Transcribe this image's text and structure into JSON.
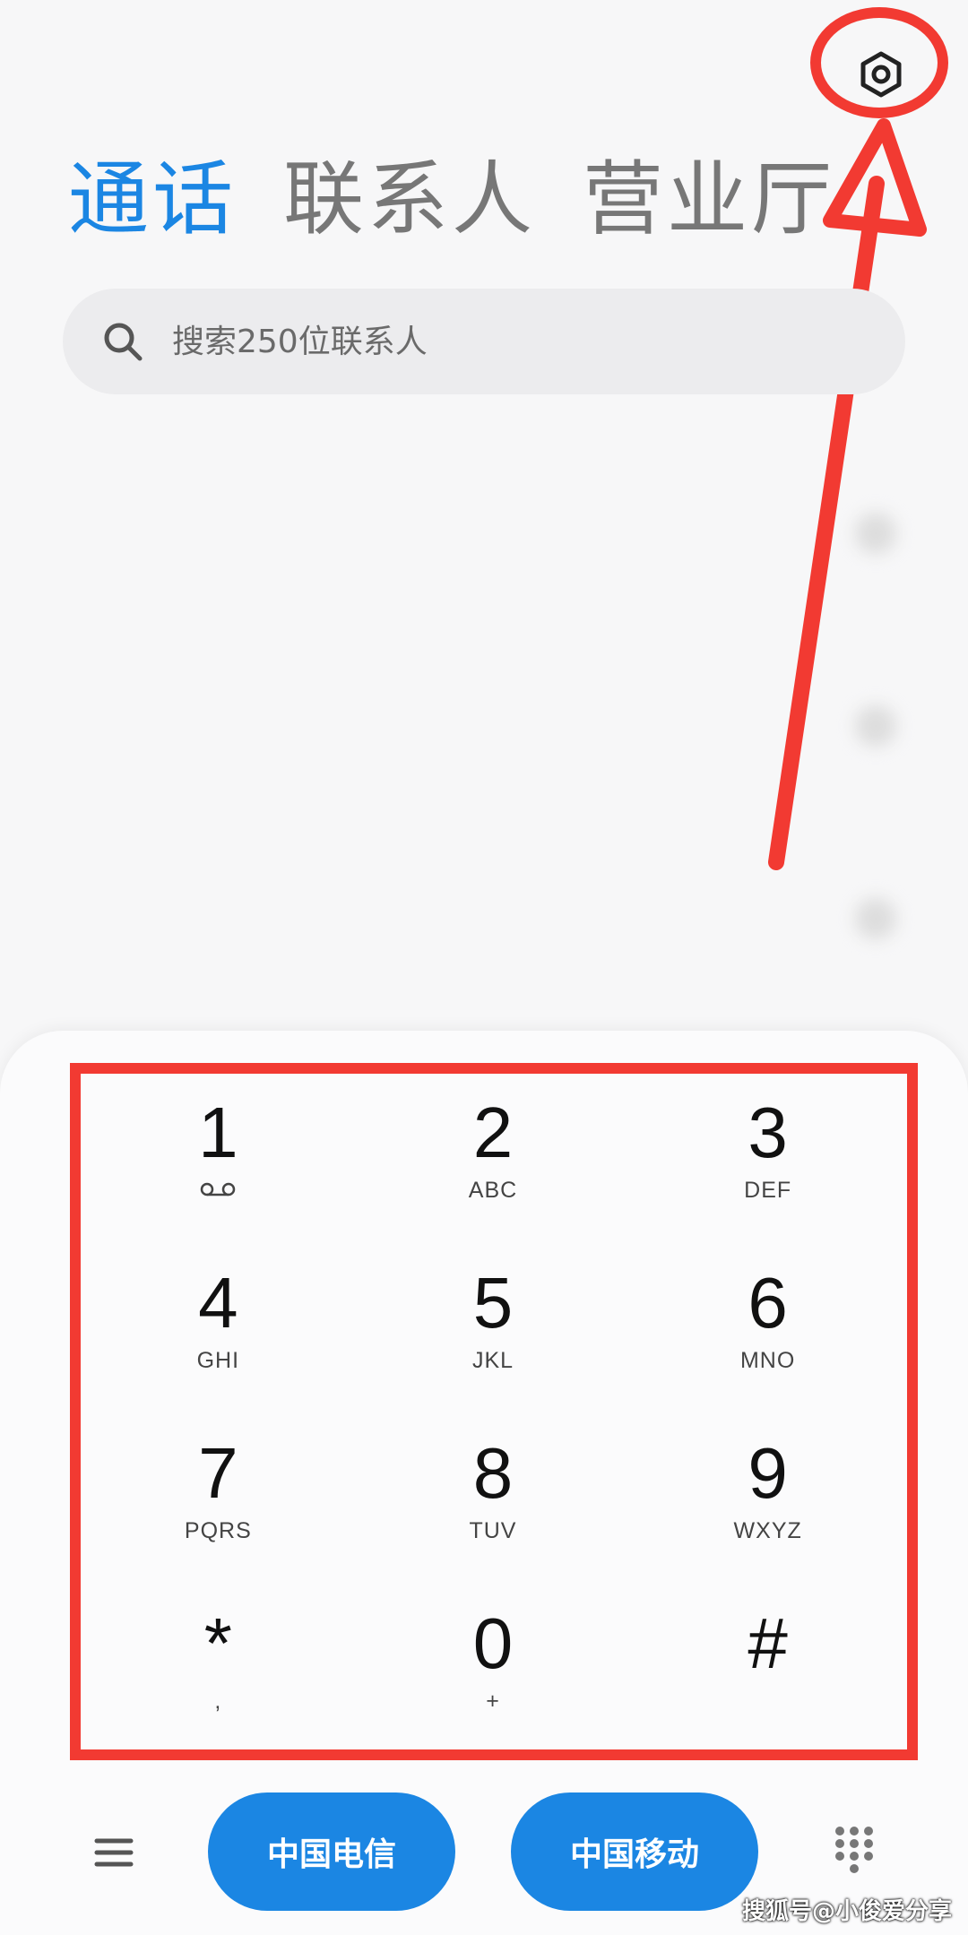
{
  "header": {
    "tabs": [
      {
        "label": "通话",
        "active": true
      },
      {
        "label": "联系人",
        "active": false
      },
      {
        "label": "营业厅",
        "active": false
      }
    ],
    "settings_icon": "gear-icon"
  },
  "search": {
    "placeholder": "搜索250位联系人",
    "icon": "search-icon"
  },
  "call_log": {
    "rows": [
      {
        "name": "",
        "detail": ""
      },
      {
        "name": "",
        "detail": ""
      },
      {
        "name": "",
        "detail": ""
      }
    ]
  },
  "dialpad": {
    "keys": [
      {
        "digit": "1",
        "letters": "",
        "icon": "voicemail-icon"
      },
      {
        "digit": "2",
        "letters": "ABC"
      },
      {
        "digit": "3",
        "letters": "DEF"
      },
      {
        "digit": "4",
        "letters": "GHI"
      },
      {
        "digit": "5",
        "letters": "JKL"
      },
      {
        "digit": "6",
        "letters": "MNO"
      },
      {
        "digit": "7",
        "letters": "PQRS"
      },
      {
        "digit": "8",
        "letters": "TUV"
      },
      {
        "digit": "9",
        "letters": "WXYZ"
      },
      {
        "digit": "*",
        "letters": ","
      },
      {
        "digit": "0",
        "letters": "+"
      },
      {
        "digit": "#",
        "letters": ""
      }
    ]
  },
  "bottom_bar": {
    "sim1_label": "中国电信",
    "sim2_label": "中国移动",
    "menu_icon": "menu-icon",
    "keypad_toggle_icon": "dialpad-icon"
  },
  "watermark": "搜狐号@小俊爱分享",
  "colors": {
    "accent": "#1b86e3",
    "annotation": "#f23a32",
    "background": "#f7f7f8"
  }
}
